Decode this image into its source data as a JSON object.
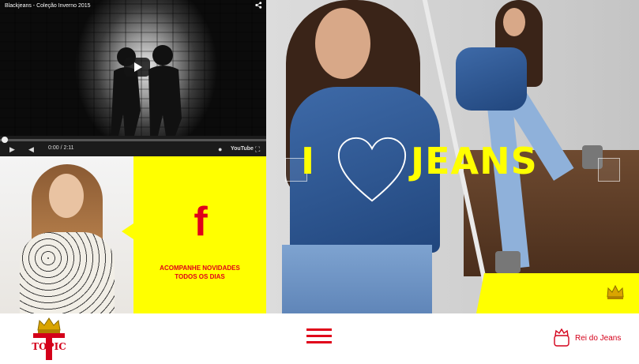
{
  "video": {
    "title": "Blackjeans - Coleção Inverno 2015",
    "icons": {
      "share": "share-icon",
      "play": "play-icon",
      "volume": "volume-icon",
      "captions": "captions-icon",
      "fullscreen": "fullscreen-icon"
    },
    "time": "0:00 / 2:11",
    "progress": 0.0,
    "brand": "YouTube"
  },
  "facebook": {
    "icon": "f",
    "caption_line1": "ACOMPANHE NOVIDADES",
    "caption_line2": "TODOS OS DIAS",
    "accent": "#e0001a",
    "bg": "#ffff00"
  },
  "hero": {
    "text_left": "I",
    "text_right": "JEANS",
    "accent": "#ffff00"
  },
  "footer": {
    "logo_text": "TOPIC",
    "rei_label": "Rei do Jeans",
    "accent": "#d4001a"
  }
}
